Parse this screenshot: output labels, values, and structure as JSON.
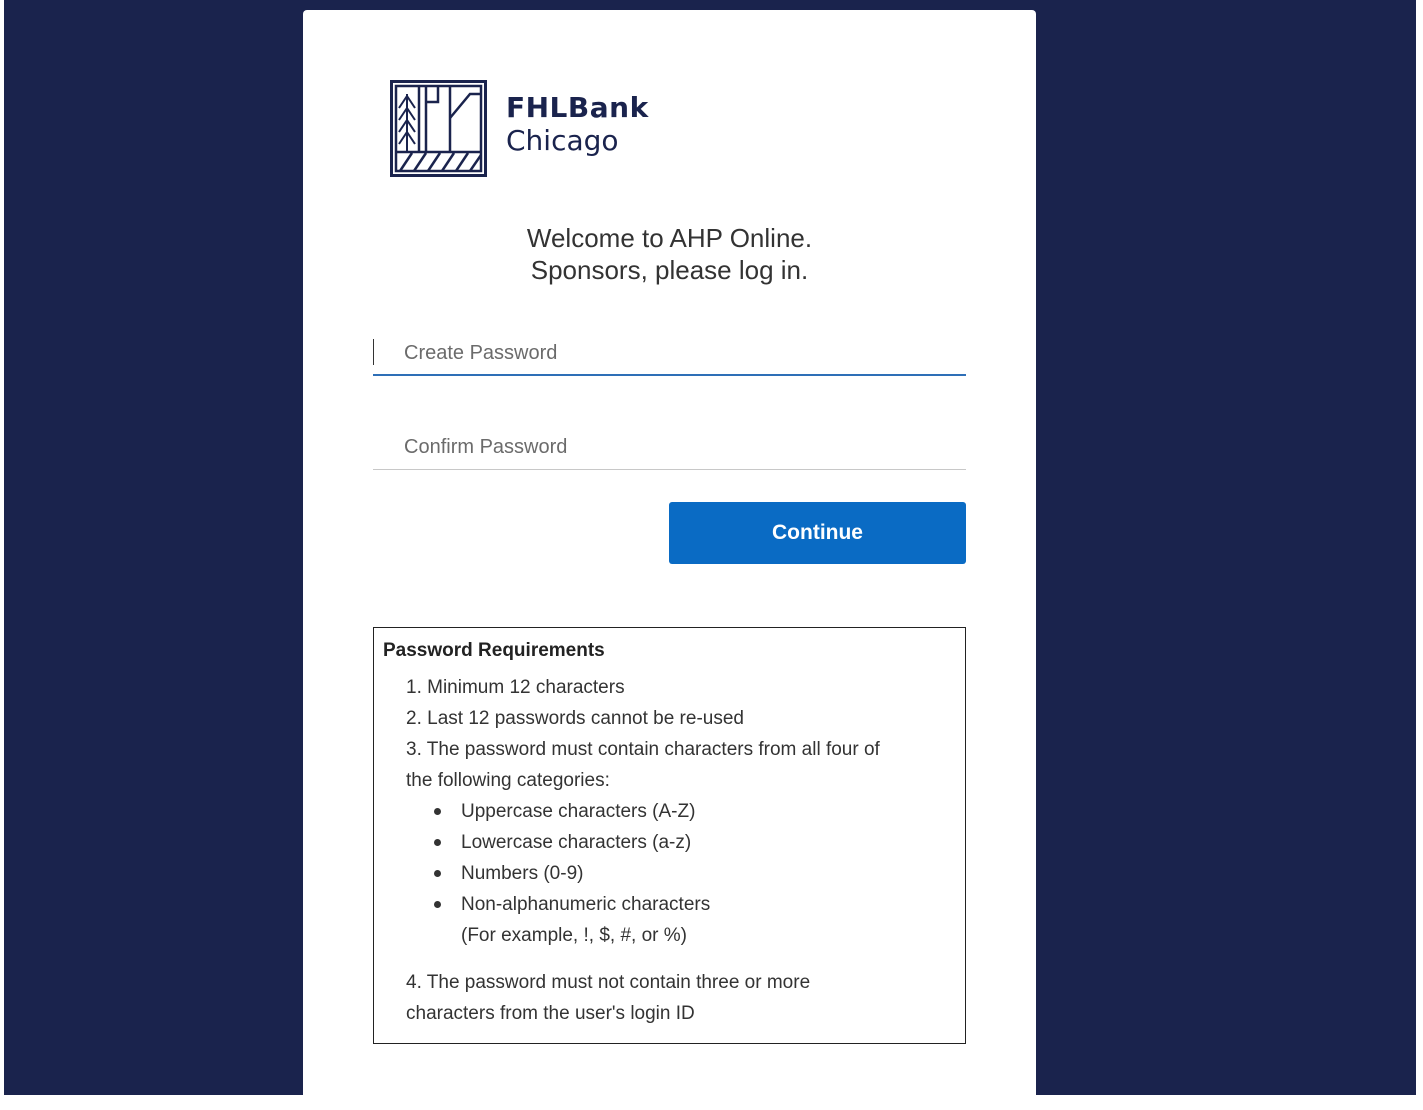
{
  "logo": {
    "line1": "FHLBank",
    "line2": "Chicago",
    "icon": "fhlbank-building-logo-icon"
  },
  "welcome": {
    "line1": "Welcome to AHP Online.",
    "line2": "Sponsors, please log in."
  },
  "form": {
    "create_placeholder": "Create Password",
    "confirm_placeholder": "Confirm Password",
    "continue_label": "Continue"
  },
  "requirements": {
    "title": "Password Requirements",
    "item1": "1. Minimum 12 characters",
    "item2": "2. Last 12 passwords cannot be re-used",
    "item3_line1": "3. The password must contain characters from all four of",
    "item3_line2": "the following categories:",
    "categories": [
      "Uppercase characters (A-Z)",
      "Lowercase characters (a-z)",
      "Numbers (0-9)",
      "Non-alphanumeric characters"
    ],
    "category4_example": "(For example, !, $, #, or %)",
    "item4_line1": "4. The password must not contain three or more",
    "item4_line2": "characters from the user's login ID"
  },
  "colors": {
    "background": "#1a234d",
    "button": "#0a6bc4",
    "focus_underline": "#2e6fb7"
  }
}
